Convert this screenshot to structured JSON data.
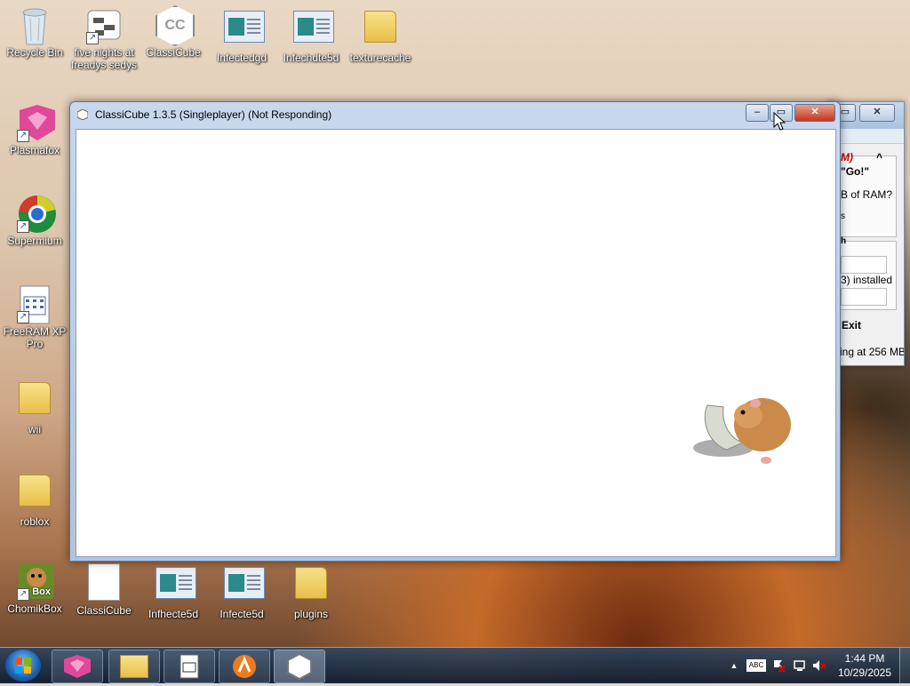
{
  "desktop": {
    "icons_top": [
      {
        "name": "recycle-bin",
        "label": "Recycle Bin"
      },
      {
        "name": "five-nights",
        "label": "five nights at freadys sedys"
      },
      {
        "name": "classicube-top",
        "label": "ClassiCube"
      },
      {
        "name": "infected-gd",
        "label": "Infectedgd"
      },
      {
        "name": "infechdte5d",
        "label": "Infechdte5d"
      },
      {
        "name": "texturecache",
        "label": "texturecache"
      }
    ],
    "icons_left": [
      {
        "name": "plasmafox",
        "label": "Plasmafox"
      },
      {
        "name": "supermium",
        "label": "Supermium"
      },
      {
        "name": "freeram",
        "label": "FreeRAM XP Pro"
      },
      {
        "name": "wii",
        "label": "wii"
      },
      {
        "name": "roblox",
        "label": "roblox"
      }
    ],
    "icons_bottom": [
      {
        "name": "chomikbox",
        "label": "ChomikBox"
      },
      {
        "name": "classicube-bottom",
        "label": "ClassiCube"
      },
      {
        "name": "infhecte5d",
        "label": "Infhecte5d"
      },
      {
        "name": "infecte5d",
        "label": "Infecte5d"
      },
      {
        "name": "plugins",
        "label": "plugins"
      }
    ],
    "chomikbox_badge": "Box"
  },
  "main_window": {
    "title": "ClassiCube 1.3.5 (Singleplayer) (Not Responding)",
    "logo": "CC"
  },
  "back_window": {
    "line1": "M)",
    "line2": "\"Go!\"",
    "line3": "B of RAM?",
    "line4": "s",
    "line5": "h",
    "line6": "3) installed",
    "exit": "Exit",
    "status": "ing at 256 MB"
  },
  "taskbar": {
    "clock_time": "1:44 PM",
    "clock_date": "10/29/2025",
    "tray_chevron": "▲",
    "tray_keyboard": "ABC"
  }
}
